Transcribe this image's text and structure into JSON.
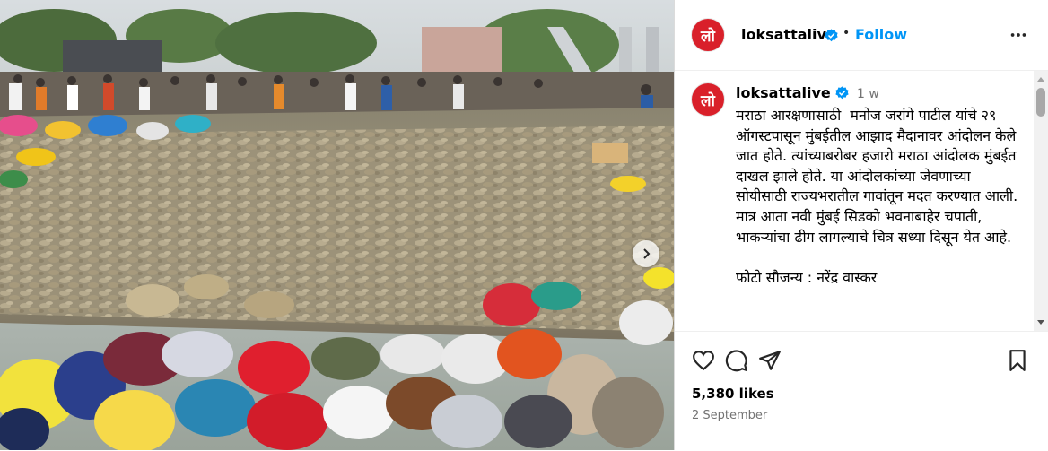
{
  "account": {
    "username": "loksattalive",
    "avatar_text": "लो",
    "verified_icon": "verified-badge-icon",
    "follow_label": "Follow",
    "separator": "•"
  },
  "caption": {
    "username": "loksattalive",
    "time_ago": "1 w",
    "text": "मराठा आरक्षणासाठी  मनोज जरांगे पाटील यांचे २९ ऑगस्टपासून मुंबईतील आझाद मैदानावर आंदोलन केले जात होते. त्यांच्याबरोबर हजारो मराठा आंदोलक मुंबईत दाखल झाले होते. या आंदोलकांच्या जेवणाच्या सोयीसाठी राज्यभरातील गावांतून मदत करण्यात आली. मात्र आता नवी मुंबई सिडको भवनाबाहेर चपाती, भाकऱ्यांचा ढीग लागल्याचे चित्र सध्या दिसून येत आहे.\n\nफोटो सौजन्य : नरेंद्र वास्कर"
  },
  "engagement": {
    "likes": "5,380 likes",
    "date": "2 September"
  },
  "icons": {
    "like": "heart-icon",
    "comment": "comment-icon",
    "share": "paper-plane-icon",
    "save": "bookmark-icon",
    "more": "more-options-icon",
    "next": "chevron-right-icon"
  },
  "colors": {
    "brand_red": "#d9202a",
    "link_blue": "#0095f6",
    "verified_blue": "#0095f6",
    "muted": "#737373"
  }
}
